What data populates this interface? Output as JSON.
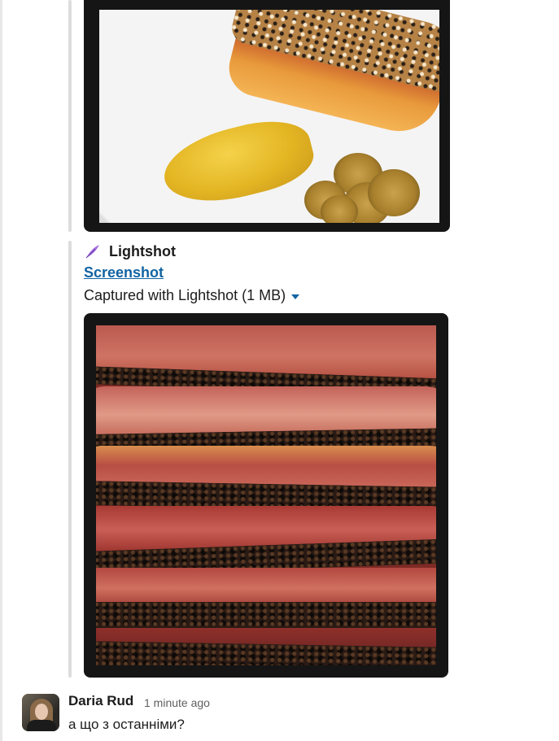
{
  "lightshot": {
    "title": "Lightshot",
    "link_text": "Screenshot",
    "caption": "Captured with Lightshot (1 MB)"
  },
  "message": {
    "author": "Daria Rud",
    "timestamp": "1 minute ago",
    "text": "а що з останніми?"
  },
  "colors": {
    "link": "#1264a3",
    "feather": "#a56de2",
    "text": "#1d1c1d",
    "muted": "#616061"
  },
  "icons": [
    "feather-icon",
    "caret-down-icon"
  ]
}
